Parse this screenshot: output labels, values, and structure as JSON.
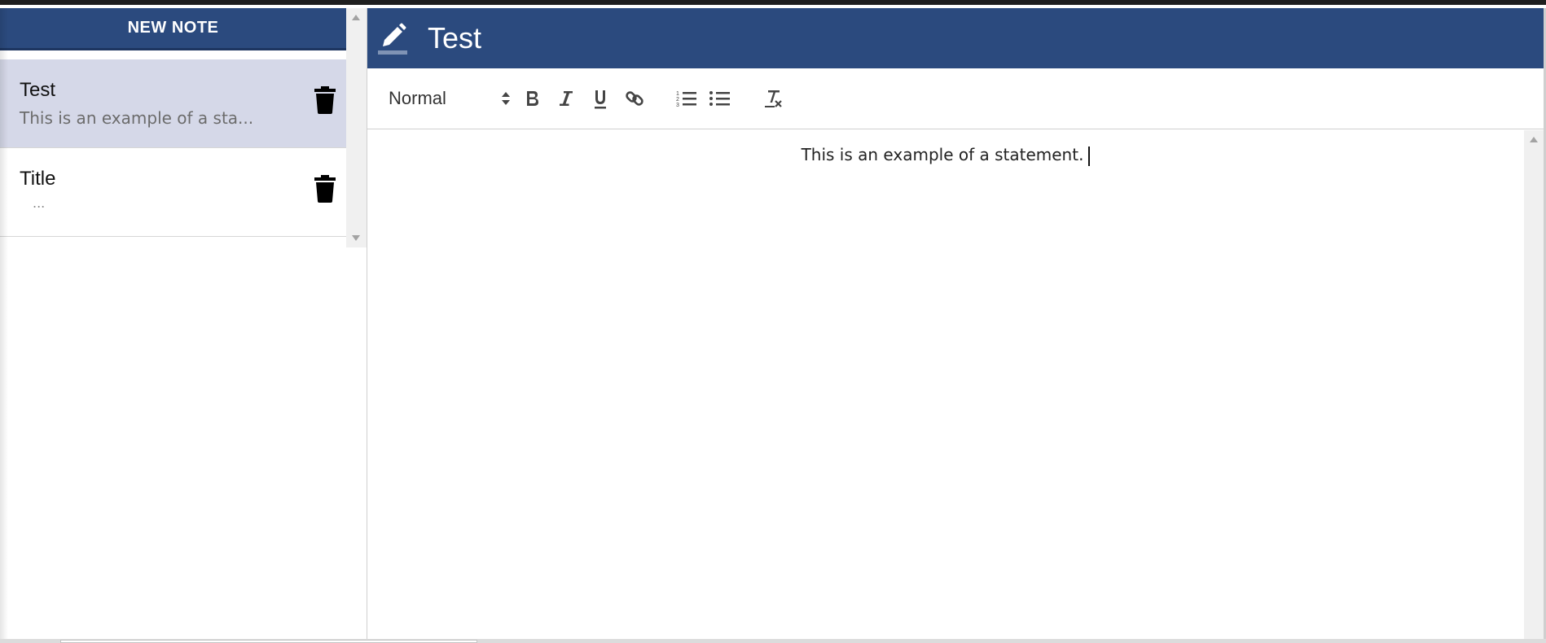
{
  "sidebar": {
    "new_note_label": "NEW NOTE",
    "notes": [
      {
        "title": "Test",
        "preview": "This is an example of a sta...",
        "selected": true
      },
      {
        "title": "Title",
        "preview": "...",
        "selected": false
      }
    ]
  },
  "editor": {
    "title": "Test",
    "toolbar": {
      "format_value": "Normal",
      "buttons": [
        "bold-icon",
        "italic-icon",
        "underline-icon",
        "link-icon",
        "ordered-list-icon",
        "bullet-list-icon",
        "clear-format-icon"
      ]
    },
    "content": "This is an example of a statement."
  },
  "colors": {
    "header_blue": "#2b4a7e",
    "selected_note_bg": "#d5d8e8"
  }
}
